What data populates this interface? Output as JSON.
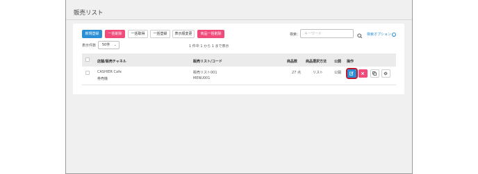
{
  "page": {
    "title": "販売リスト"
  },
  "toolbar": {
    "new_label": "新規登録",
    "bulk_delete_label": "一括削除",
    "bulk_get_label": "一括取得",
    "bulk_register_label": "一括登録",
    "display_order_label": "表示順変更",
    "product_bulk_delete_label": "商品一括削除"
  },
  "search": {
    "label": "検索：",
    "placeholder": "キーワード",
    "options_label": "検索オプション"
  },
  "pagination": {
    "count_label": "表示件数",
    "count_value": "50件",
    "record_info": "1 件中 1 から 1 まで表示"
  },
  "table": {
    "headers": {
      "store": "店舗/販売チャネル",
      "list_code": "販売リスト/コード",
      "product_count": "商品数",
      "selection_method": "商品選択方法",
      "published": "公開",
      "actions": "操作"
    },
    "rows": [
      {
        "store_line1": "CASHIER Cafe",
        "store_line2": "券売機",
        "list_name": "販売リスト001",
        "list_code": "MENU001",
        "product_count": "27 点",
        "selection_method": "リスト",
        "published": "公開"
      }
    ]
  },
  "colors": {
    "primary": "#2b8fd6",
    "danger": "#f04b7a",
    "highlight": "#c0162c"
  },
  "icons": {
    "edit": "edit-icon",
    "delete": "close-icon",
    "copy": "copy-icon",
    "settings": "gear-icon",
    "search": "search-icon",
    "options": "chevron-down-icon"
  }
}
